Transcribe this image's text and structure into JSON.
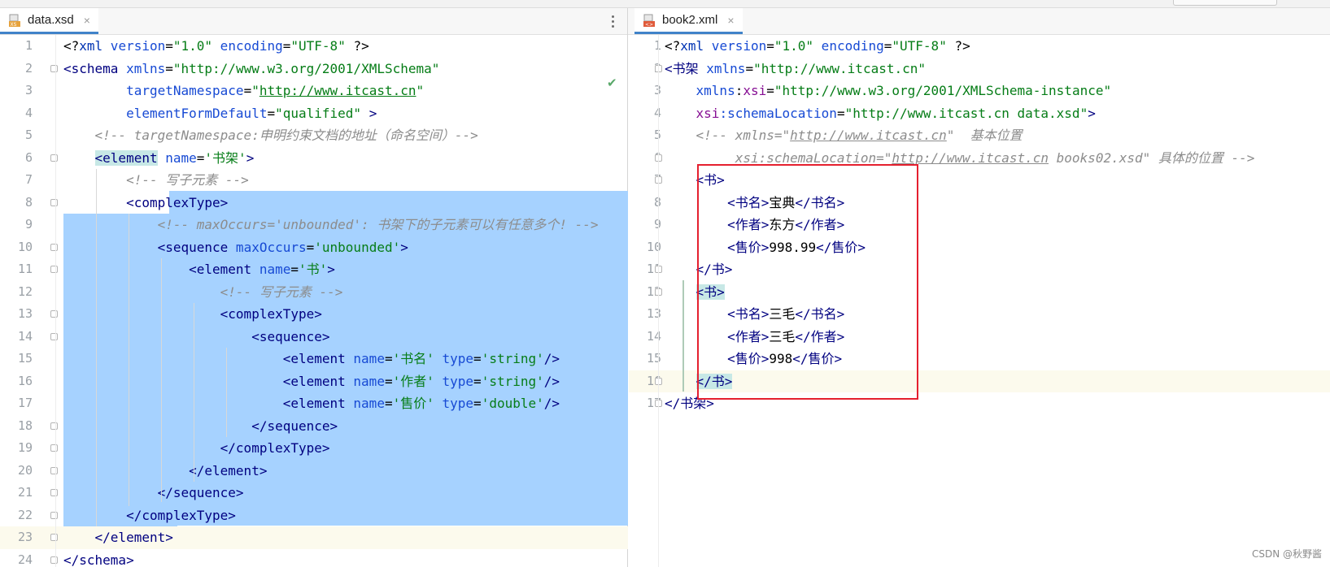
{
  "tabs": {
    "left": {
      "label": "data.xsd",
      "icon": "xsd-file-icon",
      "close": "×"
    },
    "right": {
      "label": "book2.xml",
      "icon": "xml-file-icon",
      "close": "×"
    }
  },
  "left_editor": {
    "lines": [
      {
        "n": "1",
        "parts": [
          [
            "<?",
            "pi"
          ],
          [
            "xml",
            "pi2"
          ],
          [
            " version",
            "attr"
          ],
          [
            "=",
            "txt"
          ],
          [
            "\"1.0\"",
            "val"
          ],
          [
            " encoding",
            "attr"
          ],
          [
            "=",
            "txt"
          ],
          [
            "\"UTF-8\"",
            "val"
          ],
          [
            " ?>",
            "pi"
          ]
        ]
      },
      {
        "n": "2",
        "parts": [
          [
            "<schema",
            "tag"
          ],
          [
            " xmlns",
            "attr"
          ],
          [
            "=",
            "txt"
          ],
          [
            "\"http://www.w3.org/2001/XMLSchema\"",
            "val"
          ]
        ]
      },
      {
        "n": "3",
        "parts": [
          [
            "        targetNamespace",
            "attr"
          ],
          [
            "=",
            "txt"
          ],
          [
            "\"",
            "val"
          ],
          [
            "http://www.itcast.cn",
            "link"
          ],
          [
            "\"",
            "val"
          ]
        ]
      },
      {
        "n": "4",
        "parts": [
          [
            "        elementFormDefault",
            "attr"
          ],
          [
            "=",
            "txt"
          ],
          [
            "\"qualified\"",
            "val"
          ],
          [
            " >",
            "tag"
          ]
        ]
      },
      {
        "n": "5",
        "parts": [
          [
            "    <!-- targetNamespace:申明约束文档的地址（命名空间）-->",
            "cmt"
          ]
        ]
      },
      {
        "n": "6",
        "parts": [
          [
            "    ",
            "txt"
          ],
          [
            "<element",
            "tag-hl"
          ],
          [
            " name",
            "attr"
          ],
          [
            "=",
            "txt"
          ],
          [
            "'书架'",
            "val"
          ],
          [
            ">",
            "tag"
          ]
        ]
      },
      {
        "n": "7",
        "parts": [
          [
            "        <!-- 写子元素 -->",
            "cmt"
          ]
        ]
      },
      {
        "n": "8",
        "parts": [
          [
            "        <complexType>",
            "tag"
          ]
        ]
      },
      {
        "n": "9",
        "parts": [
          [
            "            <!-- maxOccurs='unbounded': 书架下的子元素可以有任意多个! -->",
            "cmt"
          ]
        ]
      },
      {
        "n": "10",
        "parts": [
          [
            "            <sequence",
            "tag"
          ],
          [
            " maxOccurs",
            "attr"
          ],
          [
            "=",
            "txt"
          ],
          [
            "'unbounded'",
            "val"
          ],
          [
            ">",
            "tag"
          ]
        ]
      },
      {
        "n": "11",
        "parts": [
          [
            "                <element",
            "tag"
          ],
          [
            " name",
            "attr"
          ],
          [
            "=",
            "txt"
          ],
          [
            "'书'",
            "val"
          ],
          [
            ">",
            "tag"
          ]
        ]
      },
      {
        "n": "12",
        "parts": [
          [
            "                    <!-- 写子元素 -->",
            "cmt"
          ]
        ]
      },
      {
        "n": "13",
        "parts": [
          [
            "                    <complexType>",
            "tag"
          ]
        ]
      },
      {
        "n": "14",
        "parts": [
          [
            "                        <sequence>",
            "tag"
          ]
        ]
      },
      {
        "n": "15",
        "parts": [
          [
            "                            <element",
            "tag"
          ],
          [
            " name",
            "attr"
          ],
          [
            "=",
            "txt"
          ],
          [
            "'书名'",
            "val"
          ],
          [
            " type",
            "attr"
          ],
          [
            "=",
            "txt"
          ],
          [
            "'string'",
            "val"
          ],
          [
            "/>",
            "tag"
          ]
        ]
      },
      {
        "n": "16",
        "parts": [
          [
            "                            <element",
            "tag"
          ],
          [
            " name",
            "attr"
          ],
          [
            "=",
            "txt"
          ],
          [
            "'作者'",
            "val"
          ],
          [
            " type",
            "attr"
          ],
          [
            "=",
            "txt"
          ],
          [
            "'string'",
            "val"
          ],
          [
            "/>",
            "tag"
          ]
        ]
      },
      {
        "n": "17",
        "parts": [
          [
            "                            <element",
            "tag"
          ],
          [
            " name",
            "attr"
          ],
          [
            "=",
            "txt"
          ],
          [
            "'售价'",
            "val"
          ],
          [
            " type",
            "attr"
          ],
          [
            "=",
            "txt"
          ],
          [
            "'double'",
            "val"
          ],
          [
            "/>",
            "tag"
          ]
        ]
      },
      {
        "n": "18",
        "parts": [
          [
            "                        </sequence>",
            "tag"
          ]
        ]
      },
      {
        "n": "19",
        "parts": [
          [
            "                    </complexType>",
            "tag"
          ]
        ]
      },
      {
        "n": "20",
        "parts": [
          [
            "                </element>",
            "tag"
          ]
        ]
      },
      {
        "n": "21",
        "parts": [
          [
            "            </sequence>",
            "tag"
          ]
        ]
      },
      {
        "n": "22",
        "parts": [
          [
            "        </complexType>",
            "tag"
          ]
        ]
      },
      {
        "n": "23",
        "parts": [
          [
            "    </element>",
            "tag"
          ]
        ]
      },
      {
        "n": "24",
        "parts": [
          [
            "</schema>",
            "tag"
          ]
        ]
      }
    ]
  },
  "right_editor": {
    "lines": [
      {
        "n": "1",
        "parts": [
          [
            "<?",
            "pi"
          ],
          [
            "xml",
            "pi2"
          ],
          [
            " version",
            "attr"
          ],
          [
            "=",
            "txt"
          ],
          [
            "\"1.0\"",
            "val"
          ],
          [
            " encoding",
            "attr"
          ],
          [
            "=",
            "txt"
          ],
          [
            "\"UTF-8\"",
            "val"
          ],
          [
            " ?>",
            "pi"
          ]
        ]
      },
      {
        "n": "2",
        "parts": [
          [
            "<书架",
            "tag"
          ],
          [
            " xmlns",
            "attr"
          ],
          [
            "=",
            "txt"
          ],
          [
            "\"http://www.itcast.cn\"",
            "val"
          ]
        ]
      },
      {
        "n": "3",
        "parts": [
          [
            "    xmlns",
            "attr"
          ],
          [
            ":",
            "txt"
          ],
          [
            "xsi",
            "ns"
          ],
          [
            "=",
            "txt"
          ],
          [
            "\"http://www.w3.org/2001/XMLSchema-instance\"",
            "val"
          ]
        ]
      },
      {
        "n": "4",
        "parts": [
          [
            "    xsi",
            "ns"
          ],
          [
            ":schemaLocation",
            "attr"
          ],
          [
            "=",
            "txt"
          ],
          [
            "\"http://www.itcast.cn data.xsd\"",
            "val"
          ],
          [
            ">",
            "tag"
          ]
        ]
      },
      {
        "n": "5",
        "parts": [
          [
            "    <!-- xmlns=\"",
            "cmt"
          ],
          [
            "http://www.itcast.cn",
            "clink"
          ],
          [
            "\"  基本位置",
            "cmt"
          ]
        ]
      },
      {
        "n": "6",
        "parts": [
          [
            "         xsi:schemaLocation=\"",
            "cmt"
          ],
          [
            "http://www.itcast.cn",
            "clink"
          ],
          [
            " books02.xsd\" 具体的位置 -->",
            "cmt"
          ]
        ]
      },
      {
        "n": "7",
        "parts": [
          [
            "    <书>",
            "tag"
          ]
        ]
      },
      {
        "n": "8",
        "parts": [
          [
            "        <书名>",
            "tag"
          ],
          [
            "宝典",
            "txt"
          ],
          [
            "</书名>",
            "tag"
          ]
        ]
      },
      {
        "n": "9",
        "parts": [
          [
            "        <作者>",
            "tag"
          ],
          [
            "东方",
            "txt"
          ],
          [
            "</作者>",
            "tag"
          ]
        ]
      },
      {
        "n": "10",
        "parts": [
          [
            "        <售价>",
            "tag"
          ],
          [
            "998.99",
            "txt"
          ],
          [
            "</售价>",
            "tag"
          ]
        ]
      },
      {
        "n": "11",
        "parts": [
          [
            "    </书>",
            "tag"
          ]
        ]
      },
      {
        "n": "12",
        "parts": [
          [
            "    ",
            "txt"
          ],
          [
            "<书>",
            "tag-hl"
          ]
        ]
      },
      {
        "n": "13",
        "parts": [
          [
            "        <书名>",
            "tag"
          ],
          [
            "三毛",
            "txt"
          ],
          [
            "</书名>",
            "tag"
          ]
        ]
      },
      {
        "n": "14",
        "parts": [
          [
            "        <作者>",
            "tag"
          ],
          [
            "三毛",
            "txt"
          ],
          [
            "</作者>",
            "tag"
          ]
        ]
      },
      {
        "n": "15",
        "parts": [
          [
            "        <售价>",
            "tag"
          ],
          [
            "998",
            "txt"
          ],
          [
            "</售价>",
            "tag"
          ]
        ]
      },
      {
        "n": "16",
        "parts": [
          [
            "    ",
            "txt"
          ],
          [
            "</书>",
            "tag-hl"
          ]
        ]
      },
      {
        "n": "17",
        "parts": [
          [
            "</书架>",
            "tag"
          ]
        ]
      }
    ]
  },
  "status": {
    "check_icon": "✔"
  },
  "watermark": "CSDN @秋野酱"
}
